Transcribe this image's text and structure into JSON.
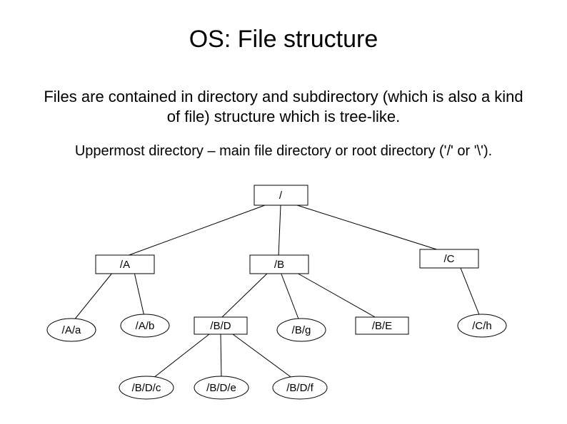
{
  "title": "OS: File structure",
  "paragraph1": "Files are contained in directory and subdirectory (which is also a kind of file) structure which is tree-like.",
  "paragraph2": "Uppermost directory – main file directory or root directory ('/' or '\\').",
  "nodes": {
    "root": "/",
    "A": "/A",
    "B": "/B",
    "C": "/C",
    "Aa": "/A/a",
    "Ab": "/A/b",
    "BD": "/B/D",
    "Bg": "/B/g",
    "BE": "/B/E",
    "Ch": "/C/h",
    "BDc": "/B/D/c",
    "BDe": "/B/D/e",
    "BDf": "/B/D/f"
  }
}
